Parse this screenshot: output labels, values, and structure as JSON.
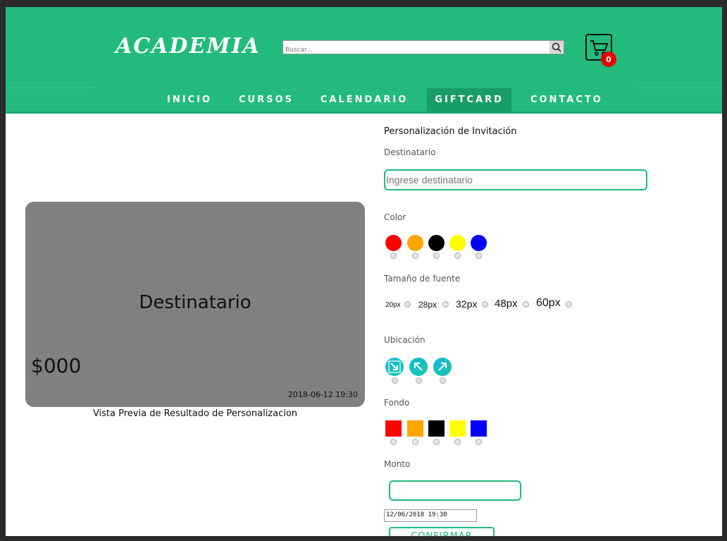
{
  "header": {
    "logo": "ACADEMIA",
    "search_placeholder": "Buscar...",
    "search_icon": "search-icon",
    "cart_icon": "cart-icon",
    "cart_count": "0",
    "colors": {
      "brand": "#22bb7b",
      "active_nav": "#189e64",
      "badge": "#e60000"
    }
  },
  "nav": {
    "items": [
      {
        "label": "INICIO"
      },
      {
        "label": "CURSOS"
      },
      {
        "label": "CALENDARIO"
      },
      {
        "label": "GIFTCARD",
        "active": true
      },
      {
        "label": "CONTACTO"
      }
    ]
  },
  "preview": {
    "recipient": "Destinatario",
    "amount": "$000",
    "datetime": "2018-06-12 19:30",
    "caption": "Vista Previa de Resultado de Personalizacion",
    "background_color": "#808080"
  },
  "form": {
    "title": "Personalización de Invitación",
    "recipient_label": "Destinatario",
    "recipient_placeholder": "Ingrese destinatario",
    "color_label": "Color",
    "colors": [
      "#ff0000",
      "#ffa500",
      "#000000",
      "#ffff00",
      "#0000ff"
    ],
    "font_size_label": "Tamaño de fuente",
    "font_sizes": [
      "20px",
      "28px",
      "32px",
      "48px",
      "60px"
    ],
    "location_label": "Ubicación",
    "locations": [
      "arrow-down-right-icon",
      "arrow-up-left-icon",
      "arrow-up-right-icon"
    ],
    "background_label": "Fondo",
    "backgrounds": [
      "#ff0000",
      "#ffa500",
      "#000000",
      "#ffff00",
      "#0000ff"
    ],
    "amount_label": "Monto",
    "datetime_value": "12/06/2018 19:30",
    "confirm_label": "CONFIRMAR"
  }
}
